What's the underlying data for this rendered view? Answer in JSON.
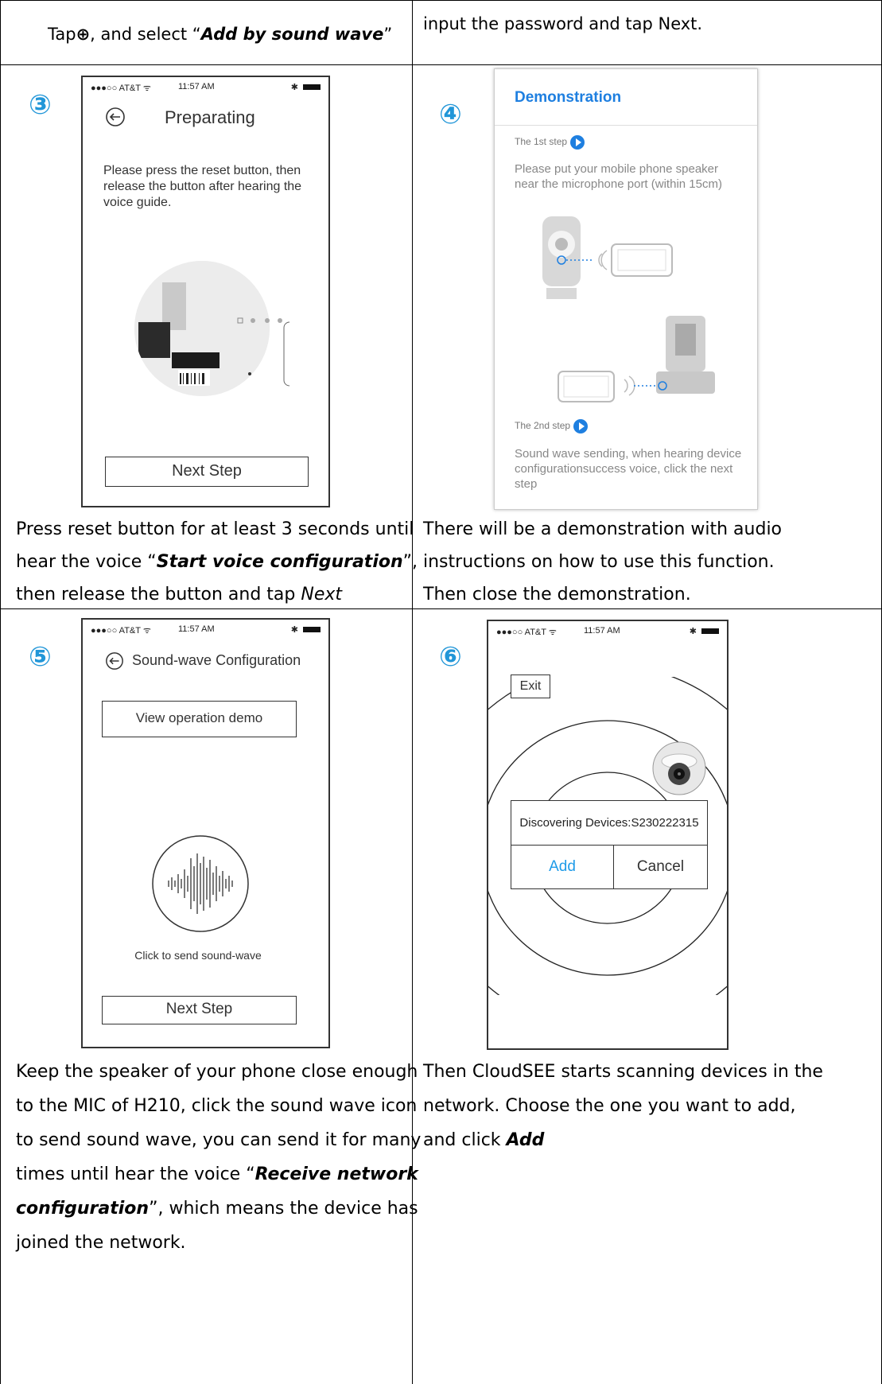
{
  "row1": {
    "left_text": "Tap⊕, and select “Add by sound wave”",
    "right_text": "input the password and tap Next."
  },
  "step3": {
    "number": "③",
    "status_carrier": "●●●○○ AT&T ᯤ",
    "status_time": "11:57 AM",
    "status_bt": "✱",
    "back_icon": "back-arrow-icon",
    "title": "Preparating",
    "instruction": "Please press the reset button, then release the button after hearing the voice guide.",
    "button": "Next Step",
    "caption_lines": [
      "Press reset button for at least 3 seconds until",
      "hear the voice “Start voice configuration”,",
      "then release the button and tap Next"
    ]
  },
  "step4": {
    "number": "④",
    "title": "Demonstration",
    "step1_label": "The 1st step",
    "step1_text": "Please put your mobile phone speaker near the microphone port (within 15cm)",
    "step2_label": "The 2nd step",
    "step2_text": "Sound wave sending, when hearing device configurationsuccess voice, click the next step",
    "caption_lines": [
      "There will be a demonstration with audio",
      "instructions on how to use this function.",
      "Then close the demonstration."
    ]
  },
  "step5": {
    "number": "⑤",
    "status_carrier": "●●●○○ AT&T ᯤ",
    "status_time": "11:57 AM",
    "status_bt": "✱",
    "title": "Sound-wave Configuration",
    "demo_button": "View operation demo",
    "send_label": "Click to send sound-wave",
    "button": "Next Step",
    "caption_lines": [
      "Keep the speaker of your phone close enough",
      "to the MIC of H210, click the sound wave icon",
      "to send sound wave, you can send it for many",
      "times until hear the voice “Receive network",
      "configuration”, which means the device has",
      "joined the network."
    ]
  },
  "step6": {
    "number": "⑥",
    "status_carrier": "●●●○○ AT&T ᯤ",
    "status_time": "11:57 AM",
    "status_bt": "✱",
    "exit_button": "Exit",
    "discover_text": "Discovering Devices:S230222315",
    "add_button": "Add",
    "cancel_button": "Cancel",
    "caption_lines": [
      "Then CloudSEE starts scanning devices in the",
      "network. Choose the one you want to add,",
      "and click Add"
    ]
  },
  "colors": {
    "accent": "#2196d8",
    "add_blue": "#1e9be8",
    "demo_blue": "#1e7fe0"
  }
}
